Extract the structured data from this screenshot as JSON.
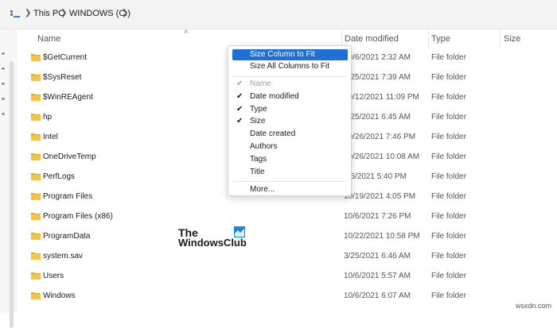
{
  "breadcrumb": {
    "items": [
      "This PC",
      "WINDOWS (C:)"
    ]
  },
  "columns": {
    "name": "Name",
    "date_modified": "Date modified",
    "type": "Type",
    "size": "Size"
  },
  "files": [
    {
      "name": "$GetCurrent",
      "date": "10/6/2021 2:32 AM",
      "type": "File folder"
    },
    {
      "name": "$SysReset",
      "date": "3/25/2021 7:39 AM",
      "type": "File folder"
    },
    {
      "name": "$WinREAgent",
      "date": "10/12/2021 11:09 PM",
      "type": "File folder"
    },
    {
      "name": "hp",
      "date": "3/25/2021 6:45 AM",
      "type": "File folder"
    },
    {
      "name": "Intel",
      "date": "10/26/2021 7:46 PM",
      "type": "File folder"
    },
    {
      "name": "OneDriveTemp",
      "date": "10/26/2021 10:08 AM",
      "type": "File folder"
    },
    {
      "name": "PerfLogs",
      "date": "6/5/2021 5:40 PM",
      "type": "File folder"
    },
    {
      "name": "Program Files",
      "date": "10/19/2021 4:05 PM",
      "type": "File folder"
    },
    {
      "name": "Program Files (x86)",
      "date": "10/6/2021 7:26 PM",
      "type": "File folder"
    },
    {
      "name": "ProgramData",
      "date": "10/22/2021 10:58 PM",
      "type": "File folder"
    },
    {
      "name": "system.sav",
      "date": "3/25/2021 6:46 AM",
      "type": "File folder"
    },
    {
      "name": "Users",
      "date": "10/6/2021 5:57 AM",
      "type": "File folder"
    },
    {
      "name": "Windows",
      "date": "10/6/2021 6:07 AM",
      "type": "File folder"
    }
  ],
  "context_menu": {
    "size_column_to_fit": "Size Column to Fit",
    "size_all_columns": "Size All Columns to Fit",
    "columns": [
      {
        "label": "Name",
        "checked": true,
        "disabled": true
      },
      {
        "label": "Date modified",
        "checked": true,
        "disabled": false
      },
      {
        "label": "Type",
        "checked": true,
        "disabled": false
      },
      {
        "label": "Size",
        "checked": true,
        "disabled": false
      },
      {
        "label": "Date created",
        "checked": false,
        "disabled": false
      },
      {
        "label": "Authors",
        "checked": false,
        "disabled": false
      },
      {
        "label": "Tags",
        "checked": false,
        "disabled": false
      },
      {
        "label": "Title",
        "checked": false,
        "disabled": false
      }
    ],
    "more": "More..."
  },
  "watermark": {
    "line1": "The",
    "line2": "WindowsClub"
  },
  "footer": {
    "site": "wsxdn.com"
  },
  "colors": {
    "accent": "#1e6fd6",
    "folder": "#f4c442",
    "folder_dark": "#e0a92a"
  }
}
